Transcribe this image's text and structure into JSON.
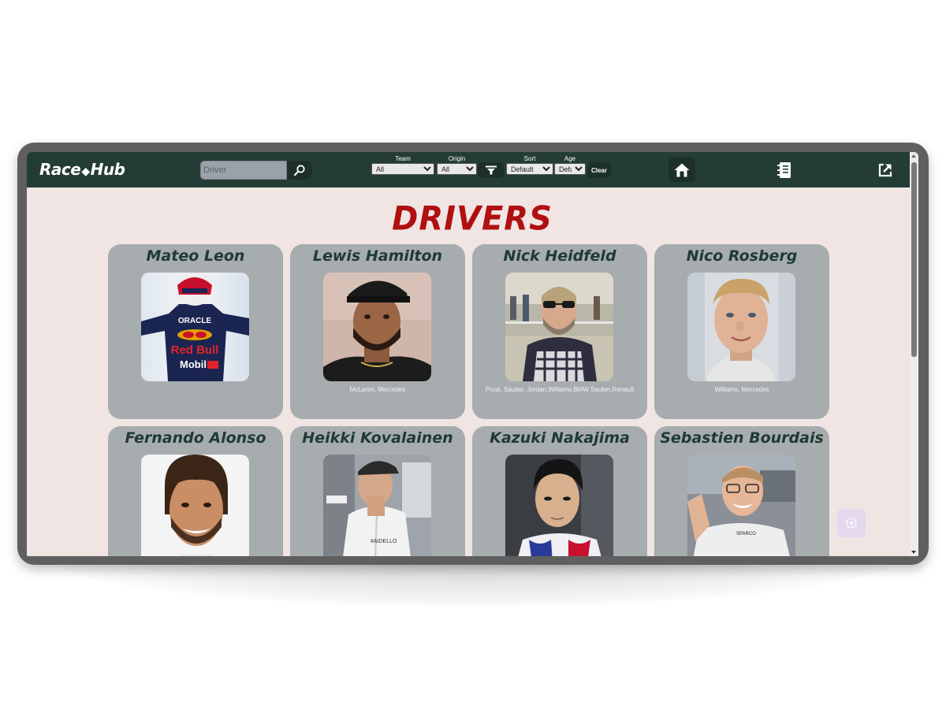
{
  "brand": {
    "logo_left": "Race",
    "logo_flag": "◆",
    "logo_right": "Hub"
  },
  "search": {
    "placeholder": "Driver",
    "value": ""
  },
  "filters": {
    "team": {
      "label": "Team",
      "selected": "All"
    },
    "origin": {
      "label": "Origin",
      "selected": "All"
    },
    "sort": {
      "label": "Sort",
      "selected": "Default"
    },
    "age": {
      "label": "Age",
      "selected": "Defau"
    },
    "clear_label": "Clear"
  },
  "nav_icons": [
    "home-icon",
    "logbook-icon",
    "share-icon"
  ],
  "page": {
    "title": "DRIVERS"
  },
  "drivers": [
    {
      "name": "Mateo Leon",
      "teams": ""
    },
    {
      "name": "Lewis Hamilton",
      "teams": "McLaren, Mercedes"
    },
    {
      "name": "Nick Heidfeld",
      "teams": "Prost, Sauber, Jordan,Williams,BMW Sauber,Renault"
    },
    {
      "name": "Nico Rosberg",
      "teams": "Williams, Mercedes"
    },
    {
      "name": "Fernando Alonso",
      "teams": ""
    },
    {
      "name": "Heikki Kovalainen",
      "teams": ""
    },
    {
      "name": "Kazuki Nakajima",
      "teams": ""
    },
    {
      "name": "Sebastien Bourdais",
      "teams": ""
    }
  ],
  "colors": {
    "navbar": "#243c36",
    "page_background": "#f0e5e3",
    "card": "#a7acae",
    "title": "#b01010",
    "card_name": "#1f3a33"
  }
}
